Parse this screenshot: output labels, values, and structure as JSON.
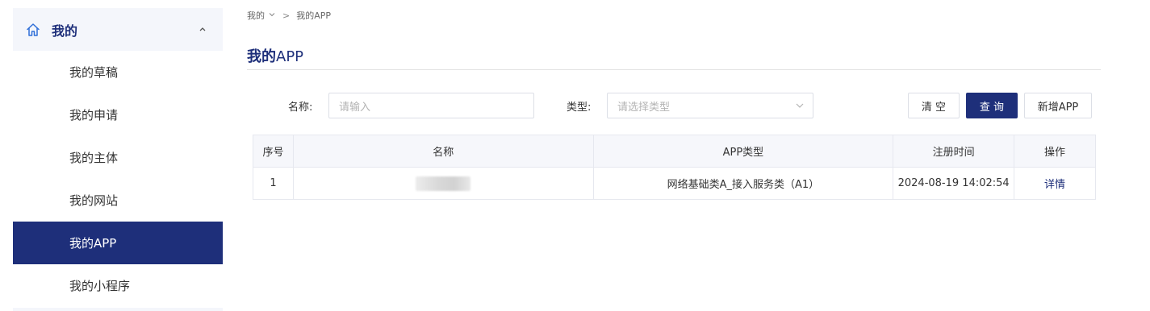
{
  "sidebar": {
    "title": "我的",
    "items": [
      {
        "label": "我的草稿"
      },
      {
        "label": "我的申请"
      },
      {
        "label": "我的主体"
      },
      {
        "label": "我的网站"
      },
      {
        "label": "我的APP"
      },
      {
        "label": "我的小程序"
      }
    ],
    "active_index": 4
  },
  "breadcrumb": {
    "root": "我的",
    "separator": ">",
    "current": "我的APP"
  },
  "page": {
    "title_bold": "我的",
    "title_rest": "APP"
  },
  "filters": {
    "name_label": "名称:",
    "name_placeholder": "请输入",
    "type_label": "类型:",
    "type_placeholder": "请选择类型"
  },
  "buttons": {
    "clear": "清 空",
    "search": "查 询",
    "add": "新增APP"
  },
  "table": {
    "headers": [
      "序号",
      "名称",
      "APP类型",
      "注册时间",
      "操作"
    ],
    "rows": [
      {
        "index": "1",
        "name": "",
        "type": "网络基础类A_接入服务类（A1）",
        "time": "2024-08-19 14:02:54",
        "action": "详情"
      }
    ]
  },
  "colors": {
    "brand": "#1e2f7a",
    "sidebar_bg": "#f4f6fb"
  },
  "icons": {
    "sidebar_head": "home-icon",
    "collapse": "chevron-up-icon",
    "breadcrumb_dropdown": "chevron-down-icon",
    "select_arrow": "chevron-down-icon"
  }
}
